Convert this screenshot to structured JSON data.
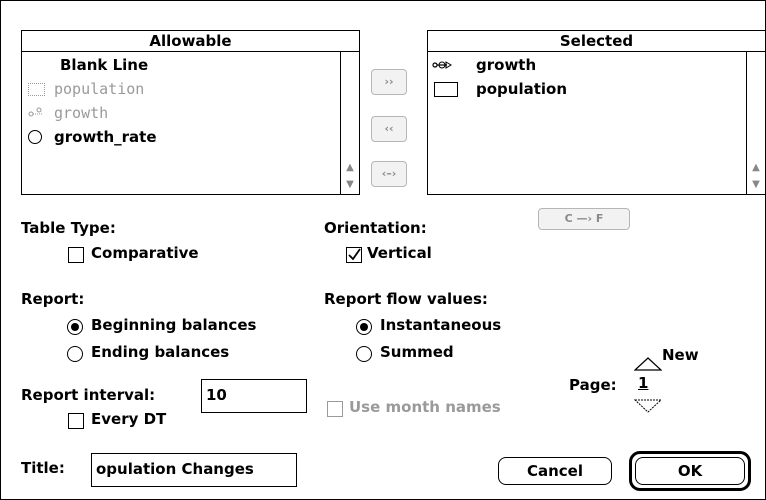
{
  "allowable": {
    "header": "Allowable",
    "items": [
      {
        "label": "Blank Line",
        "icon": "none",
        "enabled": true
      },
      {
        "label": "population",
        "icon": "stock-icon",
        "enabled": false
      },
      {
        "label": "growth",
        "icon": "flow-icon",
        "enabled": false
      },
      {
        "label": "growth_rate",
        "icon": "converter-icon",
        "enabled": true
      }
    ]
  },
  "selected": {
    "header": "Selected",
    "items": [
      {
        "label": "growth",
        "icon": "flow-icon"
      },
      {
        "label": "population",
        "icon": "stock-icon"
      }
    ]
  },
  "move_buttons": {
    "add": "››",
    "remove": "‹‹",
    "swap": "‹–›",
    "c_to_f": "C —› F"
  },
  "table_type": {
    "label": "Table Type:",
    "comparative_label": "Comparative",
    "comparative_checked": false
  },
  "orientation": {
    "label": "Orientation:",
    "vertical_label": "Vertical",
    "vertical_checked": true
  },
  "report": {
    "label": "Report:",
    "options": [
      "Beginning balances",
      "Ending balances"
    ],
    "selected": "Beginning balances"
  },
  "report_flow": {
    "label": "Report flow values:",
    "options": [
      "Instantaneous",
      "Summed"
    ],
    "selected": "Instantaneous"
  },
  "report_interval": {
    "label": "Report interval:",
    "value": "10",
    "every_dt_label": "Every DT",
    "every_dt_checked": false
  },
  "month_names": {
    "label": "Use month names",
    "checked": false,
    "enabled": false
  },
  "page": {
    "label": "Page:",
    "value": "1",
    "new_label": "New"
  },
  "title": {
    "label": "Title:",
    "value": "opulation Changes"
  },
  "buttons": {
    "cancel": "Cancel",
    "ok": "OK"
  },
  "colors": {
    "disabled_text": "#9a9a9a",
    "border": "#000000"
  }
}
